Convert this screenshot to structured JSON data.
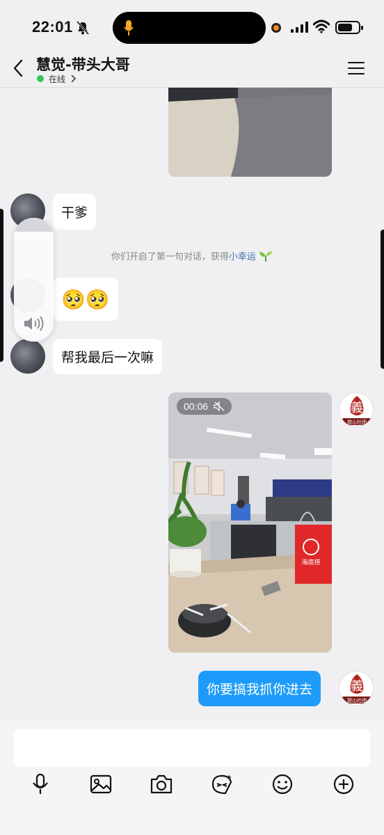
{
  "status_bar": {
    "time": "22:01"
  },
  "header": {
    "title": "慧觉-带头大哥",
    "status": "在线"
  },
  "messages": [
    {
      "type": "image",
      "side": "right"
    },
    {
      "type": "text",
      "side": "left",
      "text": "干爹"
    },
    {
      "type": "system",
      "text_prefix": "你们开启了第一句对话，获得",
      "highlight": "小幸运",
      "icon": "sprout-icon"
    },
    {
      "type": "emoji",
      "side": "left",
      "text": "🥺🥺"
    },
    {
      "type": "text",
      "side": "left",
      "text": "帮我最后一次嘛"
    },
    {
      "type": "video",
      "side": "right",
      "duration": "00:06",
      "muted": true
    },
    {
      "type": "text",
      "side": "right",
      "text": "你要搞我抓你进去"
    }
  ],
  "avatar_right": {
    "logo_char": "義",
    "logo_text": "盟山社团"
  },
  "video_scene": {
    "bag_brand": "海底捞"
  },
  "toolbar": {
    "icons": [
      "microphone-icon",
      "image-icon",
      "camera-icon",
      "sticker-icon",
      "emoji-icon",
      "plus-icon"
    ]
  },
  "colors": {
    "accent_blue": "#1e9bfa",
    "online_green": "#34c759",
    "background": "#f0f0f2"
  }
}
